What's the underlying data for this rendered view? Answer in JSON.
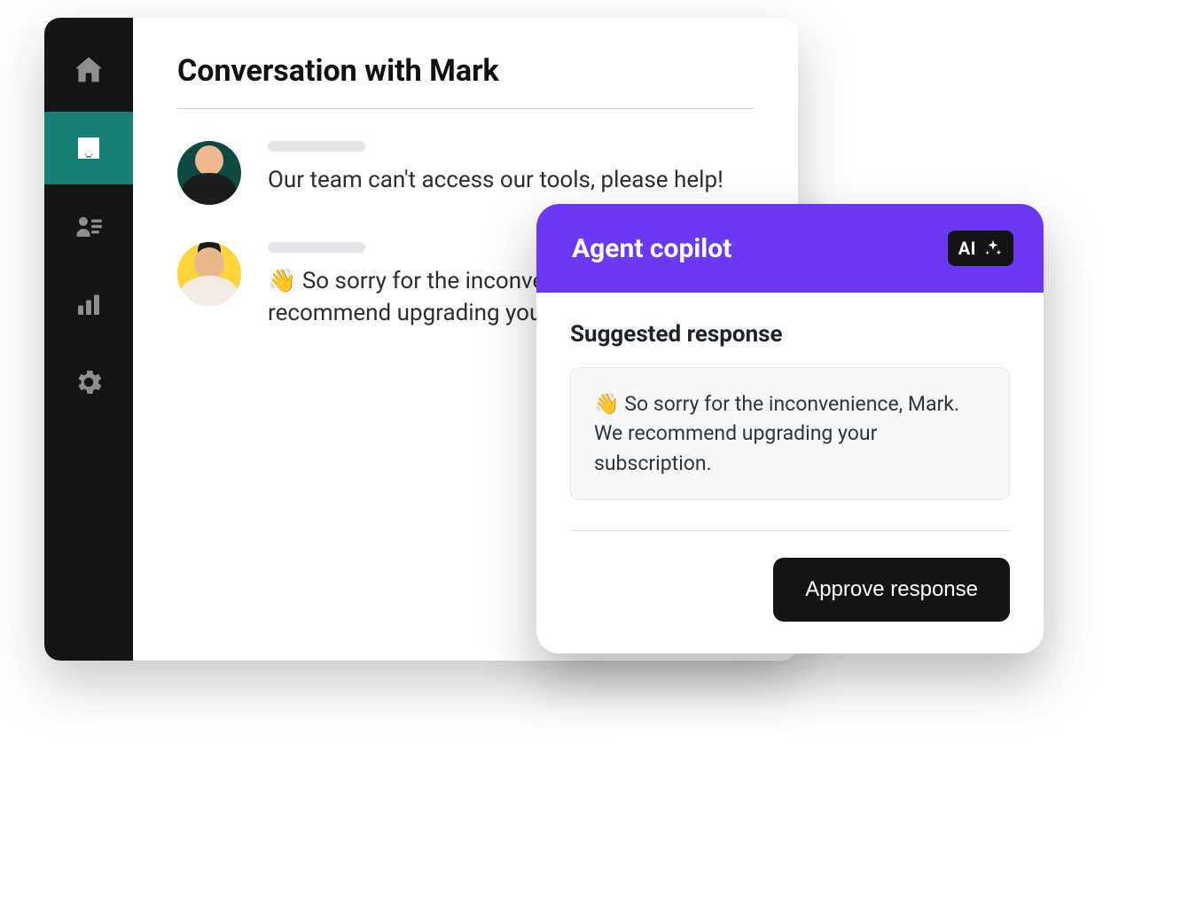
{
  "sidebar": {
    "items": [
      {
        "name": "home"
      },
      {
        "name": "inbox",
        "active": true
      },
      {
        "name": "contacts"
      },
      {
        "name": "analytics"
      },
      {
        "name": "settings"
      }
    ]
  },
  "conversation": {
    "title": "Conversation with Mark",
    "messages": [
      {
        "sender": "mark",
        "text": "Our team can't access our tools, please help!"
      },
      {
        "sender": "agent",
        "text": "👋 So sorry for the inconvenience, Mark. We recommend upgrading your subscription."
      }
    ]
  },
  "copilot": {
    "title": "Agent copilot",
    "badge": "AI",
    "suggested_label": "Suggested response",
    "suggested_text": "👋 So sorry for the inconvenience, Mark. We recommend upgrading your subscription.",
    "approve_label": "Approve response"
  }
}
